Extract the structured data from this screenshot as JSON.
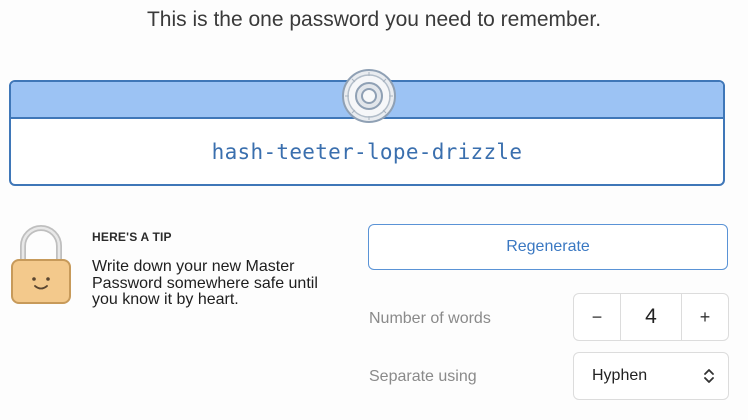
{
  "header": {
    "headline": "This is the one password you need to remember."
  },
  "password": {
    "value": "hash-teeter-lope-drizzle",
    "icon": "vault-dial-icon"
  },
  "tip": {
    "icon": "padlock-icon",
    "title": "HERE'S A TIP",
    "body": "Write down your new Master Password somewhere safe until you know it by heart."
  },
  "controls": {
    "regenerate_label": "Regenerate",
    "words_label": "Number of words",
    "words_value": "4",
    "decrement_label": "−",
    "increment_label": "+",
    "separator_label": "Separate using",
    "separator_value": "Hyphen",
    "separator_icon": "chevron-up-down-icon"
  },
  "colors": {
    "accent": "#3a78c2",
    "band": "#9cc3f4",
    "border": "#3f77b8",
    "lock_body": "#f3c98c"
  }
}
